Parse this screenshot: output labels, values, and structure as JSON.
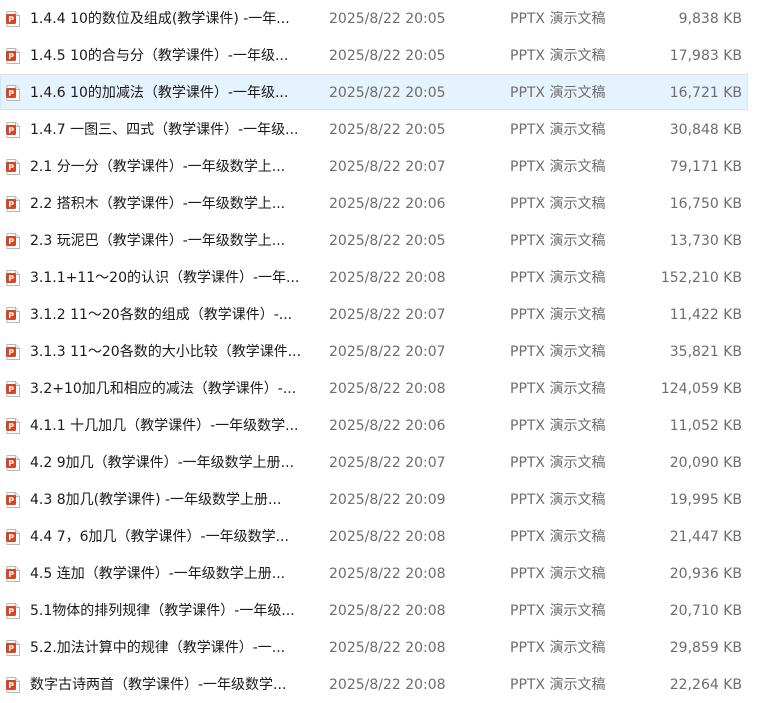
{
  "file_type_icon": "ppt-file-icon",
  "colors": {
    "icon_orange": "#d24726",
    "selected_bg": "#e5f3ff",
    "selected_border": "#cce8ff"
  },
  "files": [
    {
      "name": "1.4.4 10的数位及组成(教学课件)  -一年...",
      "date": "2025/8/22 20:05",
      "type": "PPTX 演示文稿",
      "size": "9,838 KB"
    },
    {
      "name": "1.4.5 10的合与分（教学课件）-一年级...",
      "date": "2025/8/22 20:05",
      "type": "PPTX 演示文稿",
      "size": "17,983 KB"
    },
    {
      "name": "1.4.6 10的加减法（教学课件）-一年级...",
      "date": "2025/8/22 20:05",
      "type": "PPTX 演示文稿",
      "size": "16,721 KB",
      "selected": true
    },
    {
      "name": "1.4.7 一图三、四式（教学课件）-一年级...",
      "date": "2025/8/22 20:05",
      "type": "PPTX 演示文稿",
      "size": "30,848 KB"
    },
    {
      "name": "2.1 分一分（教学课件）-一年级数学上...",
      "date": "2025/8/22 20:07",
      "type": "PPTX 演示文稿",
      "size": "79,171 KB"
    },
    {
      "name": "2.2 搭积木（教学课件）-一年级数学上...",
      "date": "2025/8/22 20:06",
      "type": "PPTX 演示文稿",
      "size": "16,750 KB"
    },
    {
      "name": "2.3 玩泥巴（教学课件）-一年级数学上...",
      "date": "2025/8/22 20:05",
      "type": "PPTX 演示文稿",
      "size": "13,730 KB"
    },
    {
      "name": "3.1.1+11～20的认识（教学课件）-一年...",
      "date": "2025/8/22 20:08",
      "type": "PPTX 演示文稿",
      "size": "152,210 KB"
    },
    {
      "name": "3.1.2 11～20各数的组成（教学课件）-...",
      "date": "2025/8/22 20:07",
      "type": "PPTX 演示文稿",
      "size": "11,422 KB"
    },
    {
      "name": "3.1.3 11～20各数的大小比较（教学课件...",
      "date": "2025/8/22 20:07",
      "type": "PPTX 演示文稿",
      "size": "35,821 KB"
    },
    {
      "name": "3.2+10加几和相应的减法（教学课件）-...",
      "date": "2025/8/22 20:08",
      "type": "PPTX 演示文稿",
      "size": "124,059 KB"
    },
    {
      "name": "4.1.1 十几加几（教学课件）-一年级数学...",
      "date": "2025/8/22 20:06",
      "type": "PPTX 演示文稿",
      "size": "11,052 KB"
    },
    {
      "name": "4.2 9加几（教学课件）-一年级数学上册...",
      "date": "2025/8/22 20:07",
      "type": "PPTX 演示文稿",
      "size": "20,090 KB"
    },
    {
      "name": "4.3 8加几(教学课件)  -一年级数学上册...",
      "date": "2025/8/22 20:09",
      "type": "PPTX 演示文稿",
      "size": "19,995 KB"
    },
    {
      "name": "4.4 7，6加几（教学课件）-一年级数学...",
      "date": "2025/8/22 20:08",
      "type": "PPTX 演示文稿",
      "size": "21,447 KB"
    },
    {
      "name": "4.5 连加（教学课件）-一年级数学上册...",
      "date": "2025/8/22 20:08",
      "type": "PPTX 演示文稿",
      "size": "20,936 KB"
    },
    {
      "name": "5.1物体的排列规律（教学课件）-一年级...",
      "date": "2025/8/22 20:08",
      "type": "PPTX 演示文稿",
      "size": "20,710 KB"
    },
    {
      "name": "5.2.加法计算中的规律（教学课件）-一...",
      "date": "2025/8/22 20:08",
      "type": "PPTX 演示文稿",
      "size": "29,859 KB"
    },
    {
      "name": "数字古诗两首（教学课件）-一年级数学...",
      "date": "2025/8/22 20:08",
      "type": "PPTX 演示文稿",
      "size": "22,264 KB"
    }
  ]
}
